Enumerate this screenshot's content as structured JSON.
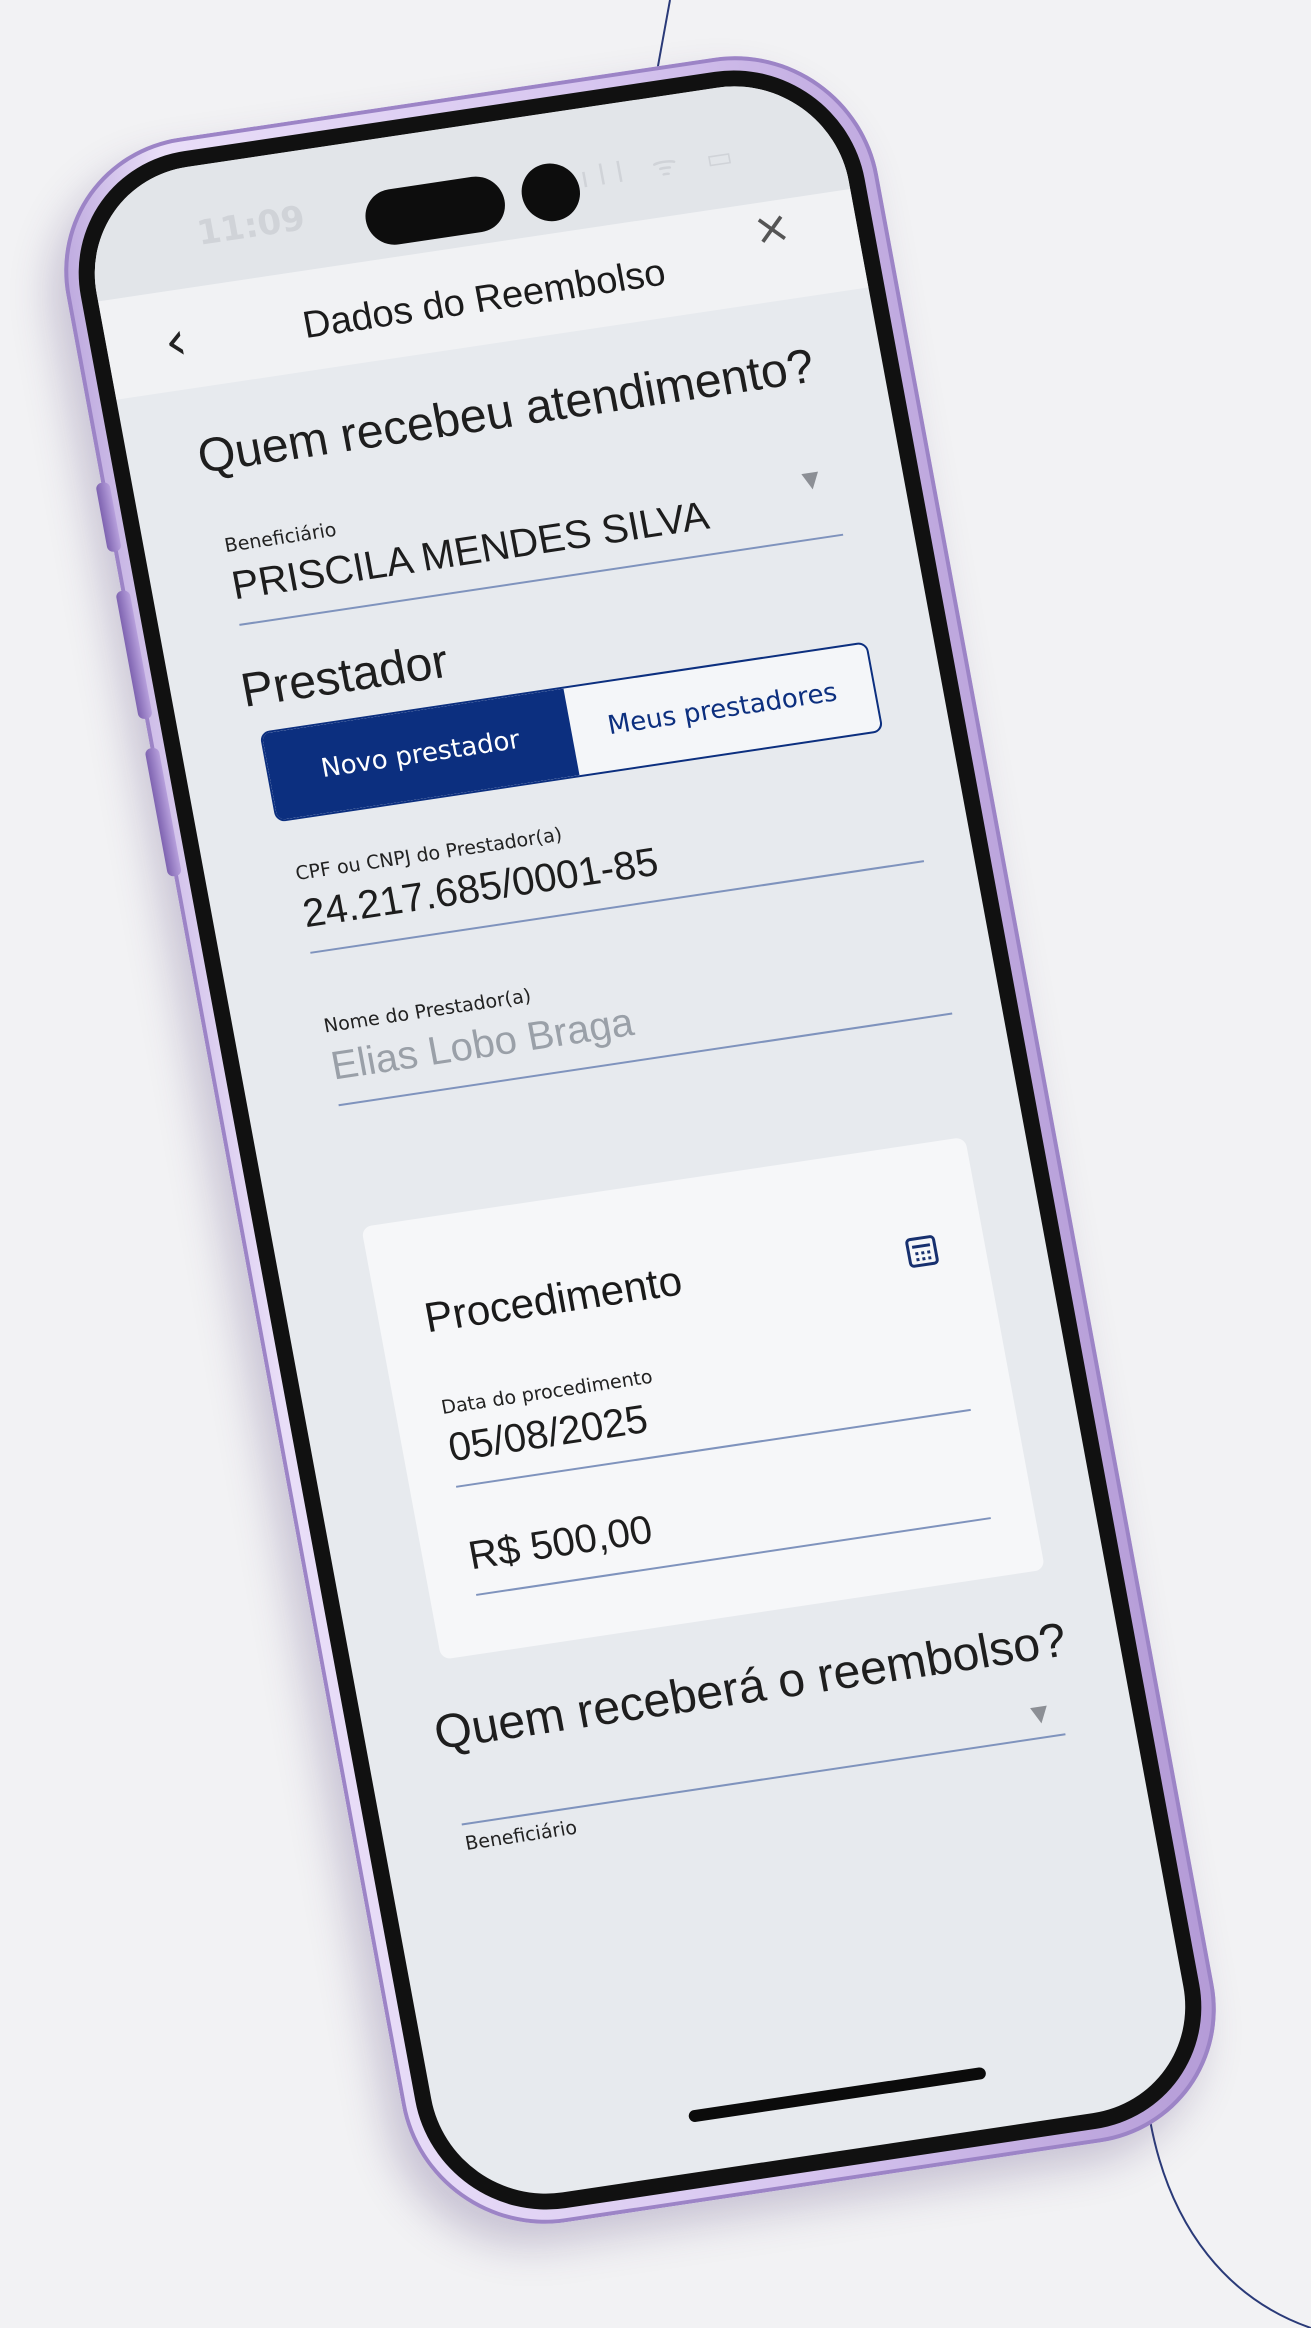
{
  "status_bar": {
    "time": "11:09",
    "icons": "ıll ᯤ ▭"
  },
  "header": {
    "title": "Dados do Reembolso",
    "back_icon": "chevron-left-icon",
    "close_icon": "close-icon"
  },
  "section_atendimento": {
    "title": "Quem recebeu atendimento?",
    "beneficiario_label": "Beneficiário",
    "beneficiario_value": "PRISCILA MENDES SILVA"
  },
  "section_prestador": {
    "title": "Prestador",
    "tabs": [
      {
        "label": "Novo prestador",
        "active": true
      },
      {
        "label": "Meus prestadores",
        "active": false
      }
    ],
    "cpf_label": "CPF ou CNPJ do Prestador(a)",
    "cpf_value": "24.217.685/0001-85",
    "nome_label": "Nome do Prestador(a)",
    "nome_value": "Elias Lobo Braga"
  },
  "procedimento": {
    "title": "Procedimento",
    "data_label": "Data do procedimento",
    "data_value": "05/08/2025",
    "valor_value": "R$ 500,00"
  },
  "section_reembolso": {
    "title": "Quem receberá o reembolso?",
    "beneficiario_label": "Beneficiário"
  },
  "colors": {
    "primary": "#0c2f7f",
    "screen_bg": "#e7eaee",
    "frame": "#d7c6f0"
  }
}
